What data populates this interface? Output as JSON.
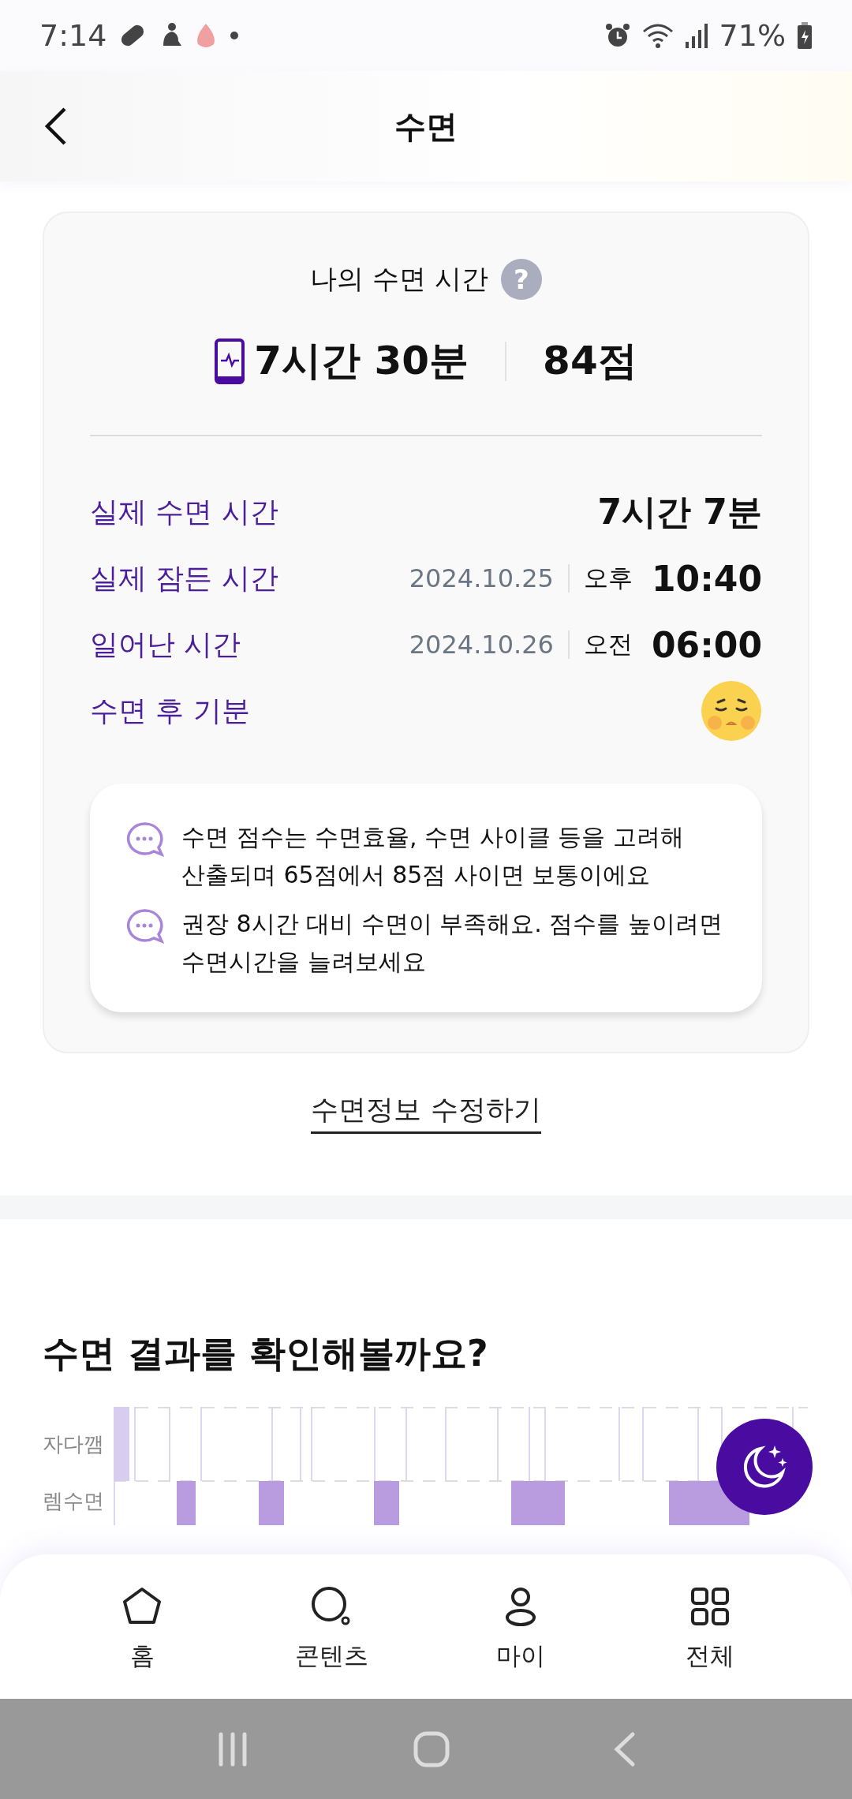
{
  "status_bar": {
    "time": "7:14",
    "battery": "71%"
  },
  "header": {
    "title": "수면"
  },
  "summary": {
    "title": "나의 수면 시간",
    "help": "?",
    "duration": "7시간 30분",
    "score": "84점",
    "rows": [
      {
        "kind": "duration",
        "label": "실제 수면 시간",
        "value": "7시간 7분"
      },
      {
        "kind": "time",
        "label": "실제 잠든 시간",
        "date": "2024.10.25",
        "period": "오후",
        "value": "10:40"
      },
      {
        "kind": "time",
        "label": "일어난 시간",
        "date": "2024.10.26",
        "period": "오전",
        "value": "06:00"
      },
      {
        "kind": "mood",
        "label": "수면 후 기분"
      }
    ],
    "tips": [
      "수면 점수는 수면효율, 수면 사이클 등을 고려해 산출되며 65점에서 85점 사이면 보통이에요",
      "권장 8시간 대비 수면이 부족해요. 점수를 높이려면 수면시간을 늘려보세요"
    ]
  },
  "edit_link": "수면정보 수정하기",
  "results": {
    "title": "수면 결과를 확인해볼까요?",
    "stages": [
      "자다깸",
      "렘수면"
    ]
  },
  "bottom_nav": [
    {
      "kind": "home",
      "label": "홈"
    },
    {
      "kind": "contents",
      "label": "콘텐츠"
    },
    {
      "kind": "my",
      "label": "마이"
    },
    {
      "kind": "all",
      "label": "전체"
    }
  ]
}
